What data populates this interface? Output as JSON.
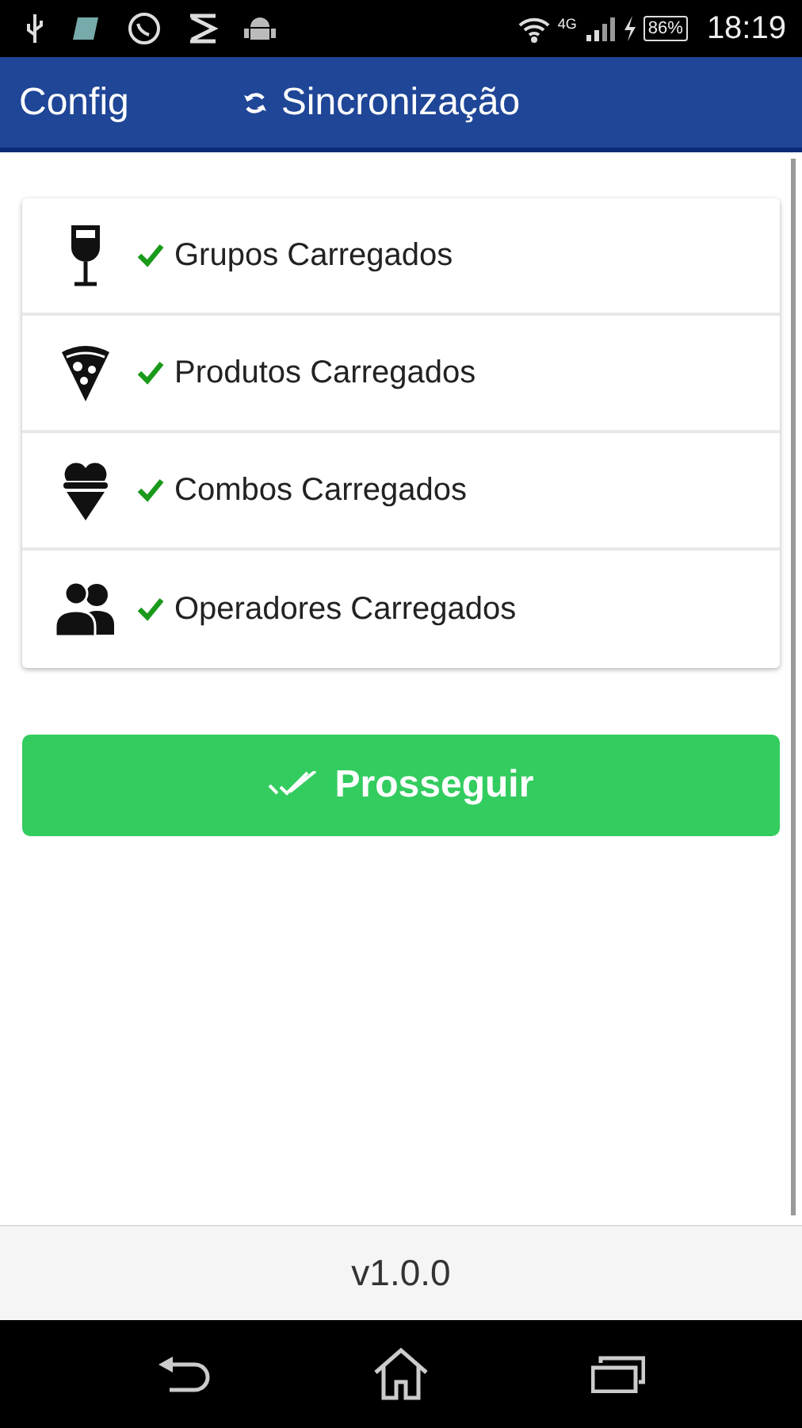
{
  "status_bar": {
    "network": "4G",
    "battery": "86%",
    "time": "18:19"
  },
  "app_bar": {
    "back_label": "Config",
    "title": "Sincronização"
  },
  "items": [
    {
      "kind": "glass",
      "label": "Grupos Carregados",
      "checked": true
    },
    {
      "kind": "pizza",
      "label": "Produtos Carregados",
      "checked": true
    },
    {
      "kind": "icecream",
      "label": "Combos Carregados",
      "checked": true
    },
    {
      "kind": "people",
      "label": "Operadores Carregados",
      "checked": true
    }
  ],
  "button": {
    "label": "Prosseguir"
  },
  "footer": {
    "version": "v1.0.0"
  }
}
